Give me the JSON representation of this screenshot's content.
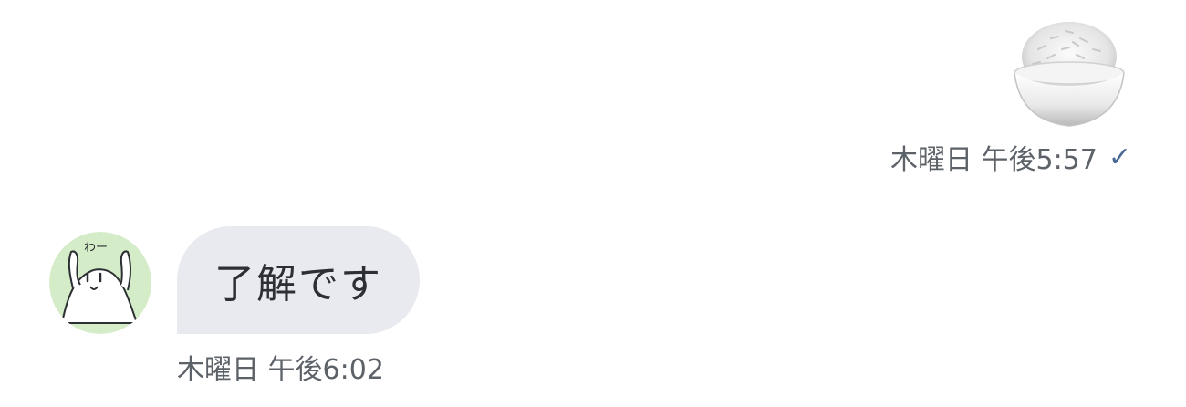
{
  "outgoing": {
    "sticker_icon": "rice-bowl-icon",
    "timestamp": "木曜日 午後5:57",
    "read_icon": "checkmark-icon",
    "read_mark": "✓"
  },
  "incoming": {
    "avatar_icon": "ghost-waving-avatar",
    "avatar_caption": "わー",
    "message": "了解です",
    "timestamp": "木曜日 午後6:02"
  },
  "colors": {
    "bubble_background": "#e8eaef",
    "avatar_background": "#d5ecc8",
    "meta_text": "#5d6268",
    "read_check": "#4a6a96"
  }
}
